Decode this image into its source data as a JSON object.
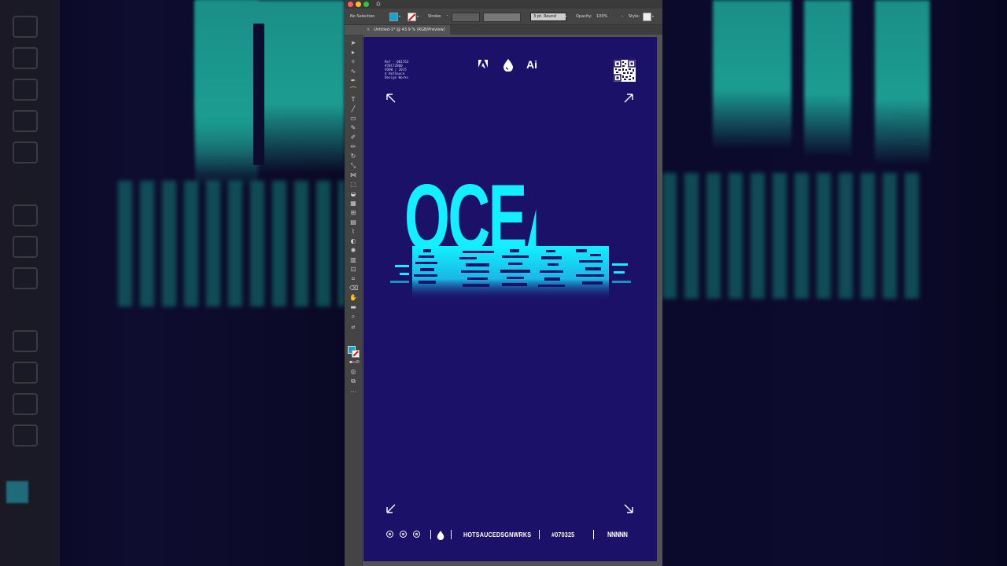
{
  "window": {
    "home_icon": "home-icon",
    "tab_title": "Untitled-1* @ 43.9 % (RGB/Preview)",
    "tab_close": "×"
  },
  "control_bar": {
    "selection": "No Selection",
    "stroke_label": "Stroke:",
    "brush": "3 pt. Round",
    "opacity_label": "Opacity:",
    "opacity_value": "100%",
    "style_label": "Style:"
  },
  "artboard": {
    "background": "#1b1168",
    "meta_text": "Ref - 001763\n#70C72800\nVOOW / 2015\n© HotSauce\nDesign Works",
    "brand_text": "Ai",
    "title": "OCEAN",
    "title_color": "#12f0ff",
    "footer": {
      "brand": "HOTSAUCEDSGNWRKS",
      "code": "#070325",
      "wave": "NNNNN"
    }
  },
  "colors": {
    "accent": "#12f0ff",
    "artboard": "#1b1168",
    "ui_panel": "#535353"
  }
}
